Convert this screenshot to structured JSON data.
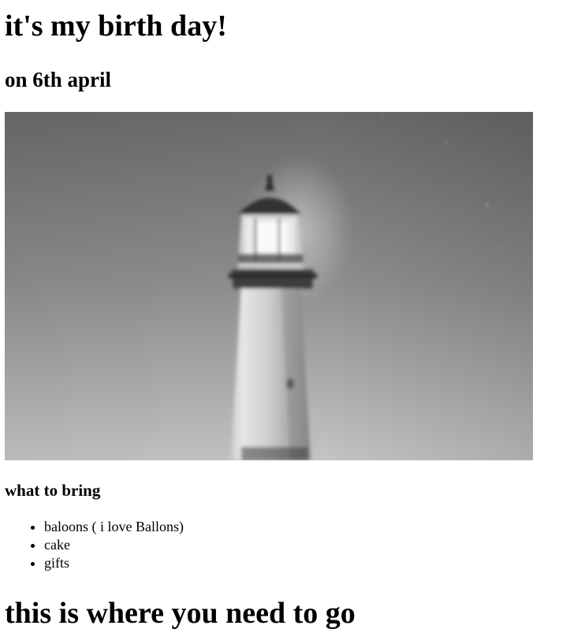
{
  "page": {
    "title": "it's my birth day!",
    "subtitle": "on 6th april",
    "image": {
      "subject": "lighthouse-photo",
      "colors": {
        "sky_top": "#616161",
        "sky_bottom": "#c2c2c2",
        "tower": "#d6d6d6",
        "tower_shadow": "#3a3a3a",
        "lantern_glow": "#f5f5f5"
      }
    },
    "bring_heading": "what to bring",
    "bring_items": [
      "baloons ( i love Ballons)",
      "cake",
      "gifts"
    ],
    "where_heading": "this is where you need to go"
  }
}
